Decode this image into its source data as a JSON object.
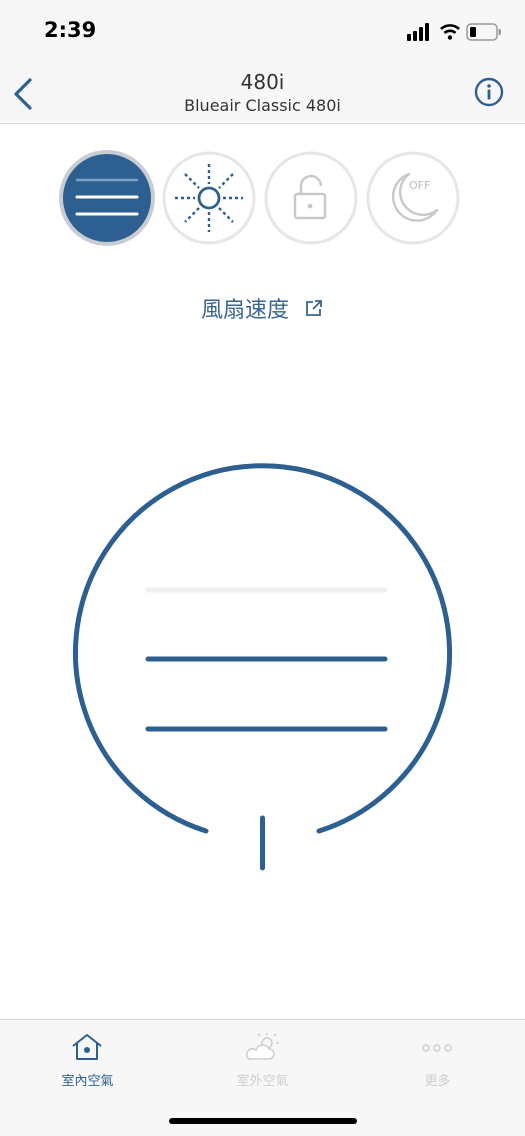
{
  "status": {
    "time": "2:39"
  },
  "nav": {
    "title": "480i",
    "subtitle": "Blueair Classic 480i"
  },
  "modes": [
    {
      "name": "fan",
      "active": true
    },
    {
      "name": "auto",
      "active": false
    },
    {
      "name": "lock",
      "active": false
    },
    {
      "name": "night",
      "active": false,
      "badge": "OFF"
    }
  ],
  "fan_link": {
    "label": "風扇速度"
  },
  "fan_speed": {
    "level": 2,
    "max": 3
  },
  "tabs": [
    {
      "label": "室內空氣",
      "active": true
    },
    {
      "label": "室外空氣",
      "active": false
    },
    {
      "label": "更多",
      "active": false
    }
  ],
  "colors": {
    "accent": "#2e5f91",
    "inactive": "#c9c9c9",
    "nav_bg": "#f7f7f7"
  }
}
